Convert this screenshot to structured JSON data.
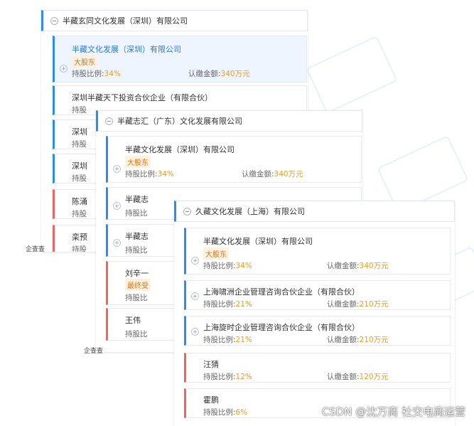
{
  "panel1": {
    "header": "半藏玄同文化发展（深圳）有限公司",
    "card1": {
      "name": "半藏文化发展（深圳）有限公司",
      "badge": "大股东",
      "ratio_label": "持股比例:",
      "ratio": "34%",
      "amount_label": "认缴金额:",
      "amount": "340万元"
    },
    "card2": {
      "name": "深圳半藏天下投资合伙企业（有限合伙）",
      "ratio_label": "持股"
    },
    "card3": {
      "name": "深圳",
      "ratio_label": "持股"
    },
    "card4": {
      "name": "深圳",
      "ratio_label": "持股"
    },
    "card5": {
      "name": "陈涌",
      "ratio_label": "持股"
    },
    "card6": {
      "name": "栾预",
      "ratio_label": "持股"
    },
    "footer_frag": "企查查"
  },
  "panel2": {
    "header": "半藏志汇（广东）文化发展有限公司",
    "card1": {
      "name": "半藏文化发展（深圳）有限公司",
      "badge": "大股东",
      "ratio_label": "持股比例:",
      "ratio": "34%",
      "amount_label": "认缴金额:",
      "amount": "340万元"
    },
    "card2": {
      "name": "半藏志",
      "ratio_label": "持股比"
    },
    "card3": {
      "name": "半藏志",
      "ratio_label": "持股比"
    },
    "card4": {
      "name": "刘辛一",
      "badge": "最终受",
      "ratio_label": "持股比"
    },
    "card5": {
      "name": "王伟",
      "ratio_label": "持股比"
    },
    "footer_frag": "企查查"
  },
  "panel3": {
    "header": "久藏文化发展（上海）有限公司",
    "cards": [
      {
        "name": "半藏文化发展（深圳）有限公司",
        "badge": "大股东",
        "ratio_label": "持股比例:",
        "ratio": "34%",
        "amount_label": "认缴金额:",
        "amount": "340万元"
      },
      {
        "name": "上海啸洲企业管理咨询合伙企业（有限合伙）",
        "ratio_label": "持股比例:",
        "ratio": "21%",
        "amount_label": "认缴金额:",
        "amount": "210万元"
      },
      {
        "name": "上海旋时企业管理咨询合伙企业（有限合伙）",
        "ratio_label": "持股比例:",
        "ratio": "21%",
        "amount_label": "认缴金额:",
        "amount": "210万元"
      },
      {
        "name": "汪猜",
        "ratio_label": "持股比例:",
        "ratio": "12%",
        "amount_label": "认缴金额:",
        "amount": "120万元"
      },
      {
        "name": "霍鹏",
        "ratio_label": "持股比例:",
        "ratio": "6%"
      }
    ]
  },
  "footer_credit": "CSDN @沈万商 社交电商运营",
  "colors": {
    "accent_blue": "#2d8cf0",
    "accent_red": "#f06363",
    "value_orange": "#f09b25"
  }
}
